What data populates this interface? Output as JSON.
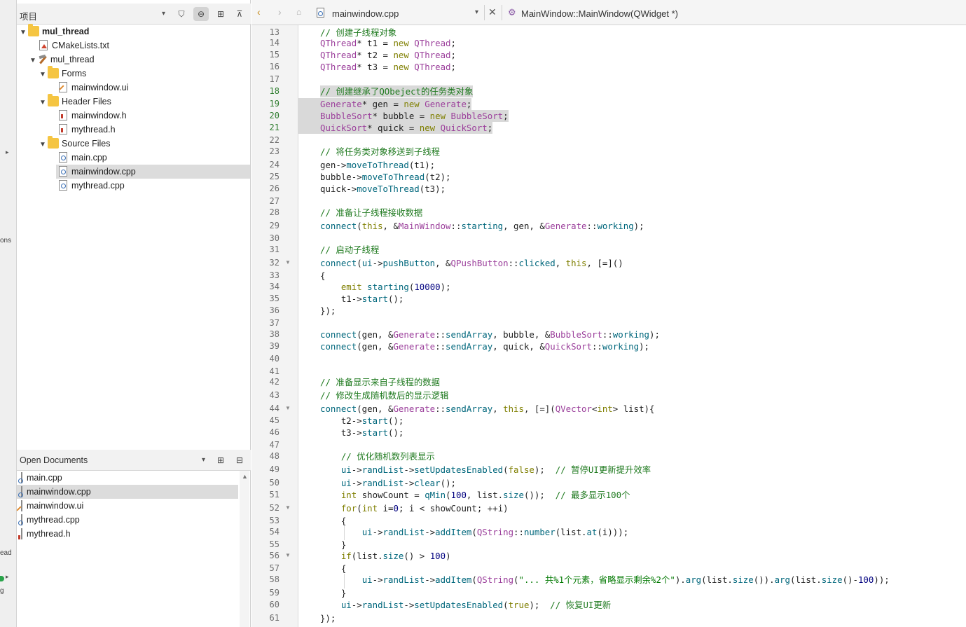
{
  "left_bar": {
    "fragments": [
      "ons",
      "ead",
      "g"
    ]
  },
  "project_pane": {
    "title": "项目",
    "tree": [
      {
        "label": "mul_thread",
        "icon": "project-folder-icon",
        "kind": "root"
      },
      {
        "label": "CMakeLists.txt",
        "icon": "cmake-file-icon",
        "kind": "txt"
      },
      {
        "label": "mul_thread",
        "icon": "build-target-icon",
        "kind": "proj"
      },
      {
        "label": "Forms",
        "icon": "folder-icon",
        "kind": "folder"
      },
      {
        "label": "mainwindow.ui",
        "icon": "ui-file-icon",
        "kind": "ui"
      },
      {
        "label": "Header Files",
        "icon": "folder-icon",
        "kind": "folder"
      },
      {
        "label": "mainwindow.h",
        "icon": "header-file-icon",
        "kind": "h"
      },
      {
        "label": "mythread.h",
        "icon": "header-file-icon",
        "kind": "h"
      },
      {
        "label": "Source Files",
        "icon": "folder-icon",
        "kind": "folder"
      },
      {
        "label": "main.cpp",
        "icon": "cpp-file-icon",
        "kind": "cpp"
      },
      {
        "label": "mainwindow.cpp",
        "icon": "cpp-file-icon",
        "kind": "cpp"
      },
      {
        "label": "mythread.cpp",
        "icon": "cpp-file-icon",
        "kind": "cpp"
      }
    ],
    "selected_item": "mainwindow.cpp"
  },
  "open_documents": {
    "title": "Open Documents",
    "items": [
      "main.cpp",
      "mainwindow.cpp",
      "mainwindow.ui",
      "mythread.cpp",
      "mythread.h"
    ],
    "selected_item": "mainwindow.cpp"
  },
  "editor_toolbar": {
    "file_name": "mainwindow.cpp",
    "symbol": "MainWindow::MainWindow(QWidget *)"
  },
  "editor": {
    "current_lines": [
      18,
      19,
      20,
      21
    ],
    "fold_lines": [
      32,
      44,
      52,
      56
    ],
    "lines": [
      {
        "n": 13,
        "text": "// 创建子线程对象"
      },
      {
        "n": 14,
        "text": "QThread* t1 = new QThread;"
      },
      {
        "n": 15,
        "text": "QThread* t2 = new QThread;"
      },
      {
        "n": 16,
        "text": "QThread* t3 = new QThread;"
      },
      {
        "n": 17,
        "text": ""
      },
      {
        "n": 18,
        "text": "// 创建继承了QObeject的任务类对象"
      },
      {
        "n": 19,
        "text": "Generate* gen = new Generate;"
      },
      {
        "n": 20,
        "text": "BubbleSort* bubble = new BubbleSort;"
      },
      {
        "n": 21,
        "text": "QuickSort* quick = new QuickSort;"
      },
      {
        "n": 22,
        "text": ""
      },
      {
        "n": 23,
        "text": "// 将任务类对象移送到子线程"
      },
      {
        "n": 24,
        "text": "gen->moveToThread(t1);"
      },
      {
        "n": 25,
        "text": "bubble->moveToThread(t2);"
      },
      {
        "n": 26,
        "text": "quick->moveToThread(t3);"
      },
      {
        "n": 27,
        "text": ""
      },
      {
        "n": 28,
        "text": "// 准备让子线程接收数据"
      },
      {
        "n": 29,
        "text": "connect(this, &MainWindow::starting, gen, &Generate::working);"
      },
      {
        "n": 30,
        "text": ""
      },
      {
        "n": 31,
        "text": "// 启动子线程"
      },
      {
        "n": 32,
        "text": "connect(ui->pushButton, &QPushButton::clicked, this, [=]()"
      },
      {
        "n": 33,
        "text": "{"
      },
      {
        "n": 34,
        "text": "    emit starting(10000);"
      },
      {
        "n": 35,
        "text": "    t1->start();"
      },
      {
        "n": 36,
        "text": "});"
      },
      {
        "n": 37,
        "text": ""
      },
      {
        "n": 38,
        "text": "connect(gen, &Generate::sendArray, bubble, &BubbleSort::working);"
      },
      {
        "n": 39,
        "text": "connect(gen, &Generate::sendArray, quick, &QuickSort::working);"
      },
      {
        "n": 40,
        "text": ""
      },
      {
        "n": 41,
        "text": ""
      },
      {
        "n": 42,
        "text": "// 准备显示来自子线程的数据"
      },
      {
        "n": 43,
        "text": "// 修改生成随机数后的显示逻辑"
      },
      {
        "n": 44,
        "text": "connect(gen, &Generate::sendArray, this, [=](QVector<int> list){"
      },
      {
        "n": 45,
        "text": "    t2->start();"
      },
      {
        "n": 46,
        "text": "    t3->start();"
      },
      {
        "n": 47,
        "text": ""
      },
      {
        "n": 48,
        "text": "    // 优化随机数列表显示"
      },
      {
        "n": 49,
        "text": "    ui->randList->setUpdatesEnabled(false);  // 暂停UI更新提升效率"
      },
      {
        "n": 50,
        "text": "    ui->randList->clear();"
      },
      {
        "n": 51,
        "text": "    int showCount = qMin(100, list.size());  // 最多显示100个"
      },
      {
        "n": 52,
        "text": "    for(int i=0; i < showCount; ++i)"
      },
      {
        "n": 53,
        "text": "    {"
      },
      {
        "n": 54,
        "text": "        ui->randList->addItem(QString::number(list.at(i)));"
      },
      {
        "n": 55,
        "text": "    }"
      },
      {
        "n": 56,
        "text": "    if(list.size() > 100)"
      },
      {
        "n": 57,
        "text": "    {"
      },
      {
        "n": 58,
        "text": "        ui->randList->addItem(QString(\"... 共%1个元素，省略显示剩余%2个\").arg(list.size()).arg(list.size()-100));"
      },
      {
        "n": 59,
        "text": "    }"
      },
      {
        "n": 60,
        "text": "    ui->randList->setUpdatesEnabled(true);  // 恢复UI更新"
      },
      {
        "n": 61,
        "text": "});"
      }
    ]
  },
  "colors": {
    "comment": "#1f7a1f",
    "type": "#9b3f9b",
    "keyword": "#7f7f00",
    "function": "#00677c",
    "number": "#00007f",
    "highlight": "#d9d9d9"
  }
}
